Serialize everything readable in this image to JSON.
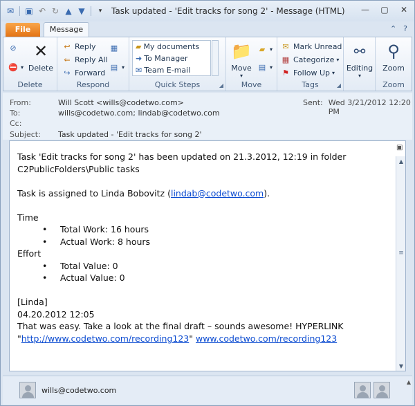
{
  "window": {
    "title": "Task updated - 'Edit tracks for song 2'  -  Message (HTML)"
  },
  "tabs": {
    "file": "File",
    "message": "Message"
  },
  "ribbon": {
    "delete_group": {
      "label": "Delete",
      "delete_button": "Delete"
    },
    "respond_group": {
      "label": "Respond",
      "reply": "Reply",
      "reply_all": "Reply All",
      "forward": "Forward"
    },
    "quick_steps_group": {
      "label": "Quick Steps",
      "items": [
        "My documents",
        "To Manager",
        "Team E-mail"
      ]
    },
    "move_group": {
      "label": "Move",
      "move_button": "Move"
    },
    "tags_group": {
      "label": "Tags",
      "mark_unread": "Mark Unread",
      "categorize": "Categorize",
      "follow_up": "Follow Up"
    },
    "editing_group": {
      "label": "",
      "editing_button": "Editing"
    },
    "zoom_group": {
      "label": "Zoom",
      "zoom_button": "Zoom"
    }
  },
  "header": {
    "from_label": "From:",
    "from_value": "Will Scott <wills@codetwo.com>",
    "to_label": "To:",
    "to_value": "wills@codetwo.com; lindab@codetwo.com",
    "cc_label": "Cc:",
    "cc_value": "",
    "subject_label": "Subject:",
    "subject_value": "Task updated - 'Edit tracks for song 2'",
    "sent_label": "Sent:",
    "sent_value": "Wed 3/21/2012 12:20 PM"
  },
  "body": {
    "line1": "Task 'Edit tracks for song 2' has been updated on 21.3.2012, 12:19 in folder",
    "line2": "C2PublicFolders\\Public tasks",
    "assigned_prefix": "Task is assigned to Linda Bobovitz (",
    "assigned_link": "lindab@codetwo.com",
    "assigned_suffix": ").",
    "time_heading": "Time",
    "time_items": [
      "Total Work: 16 hours",
      "Actual Work: 8 hours"
    ],
    "effort_heading": "Effort",
    "effort_items": [
      "Total Value: 0",
      "Actual Value: 0"
    ],
    "author": "[Linda]",
    "date": "04.20.2012 12:05",
    "comment": "That was easy. Take a look at the final draft – sounds awesome!  HYPERLINK",
    "link_quote_open": "\"",
    "link1": "http://www.codetwo.com/recording123",
    "link_quote_close": "\" ",
    "link2": "www.codetwo.com/recording123"
  },
  "people_pane": {
    "email": "wills@codetwo.com"
  }
}
